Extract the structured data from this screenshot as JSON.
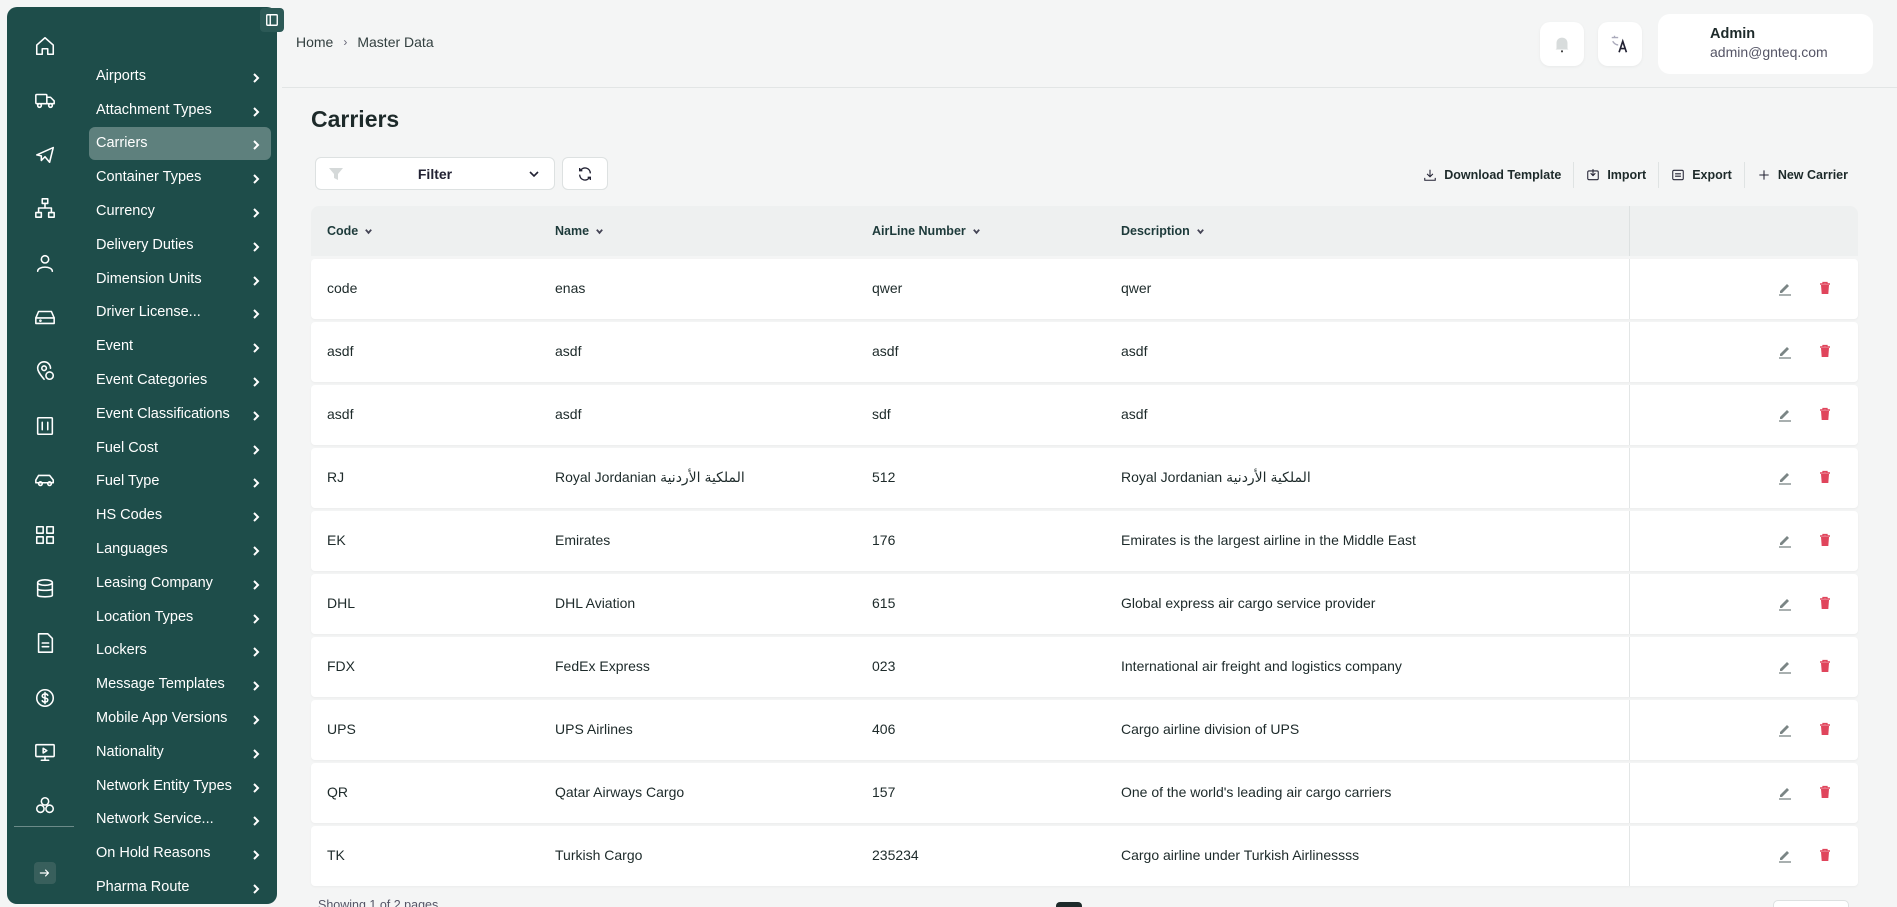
{
  "sidebar": {
    "rail_icons": [
      "home-icon",
      "truck-icon",
      "airplane-icon",
      "sitemap-icon",
      "user-icon",
      "hard-drive-icon",
      "map-pin-icon",
      "building-icon",
      "car-icon",
      "dashboard-icon",
      "database-icon",
      "document-icon",
      "dollar-icon",
      "monitor-icon",
      "network-icon"
    ],
    "logout_icon": "logout-icon",
    "menu": [
      {
        "label": "Airports"
      },
      {
        "label": "Attachment Types"
      },
      {
        "label": "Carriers",
        "active": true
      },
      {
        "label": "Container Types"
      },
      {
        "label": "Currency"
      },
      {
        "label": "Delivery Duties"
      },
      {
        "label": "Dimension Units"
      },
      {
        "label": "Driver License..."
      },
      {
        "label": "Event"
      },
      {
        "label": "Event Categories"
      },
      {
        "label": "Event Classifications"
      },
      {
        "label": "Fuel Cost"
      },
      {
        "label": "Fuel Type"
      },
      {
        "label": "HS Codes"
      },
      {
        "label": "Languages"
      },
      {
        "label": "Leasing Company"
      },
      {
        "label": "Location Types"
      },
      {
        "label": "Lockers"
      },
      {
        "label": "Message Templates"
      },
      {
        "label": "Mobile App Versions"
      },
      {
        "label": "Nationality"
      },
      {
        "label": "Network Entity Types"
      },
      {
        "label": "Network Service..."
      },
      {
        "label": "On Hold Reasons"
      },
      {
        "label": "Pharma Route"
      }
    ]
  },
  "header": {
    "breadcrumb": {
      "home": "Home",
      "current": "Master Data"
    },
    "user": {
      "name": "Admin",
      "email": "admin@gnteq.com"
    }
  },
  "page": {
    "title": "Carriers",
    "filter_label": "Filter",
    "actions": {
      "download_template": "Download Template",
      "import": "Import",
      "export": "Export",
      "new_carrier": "New Carrier"
    }
  },
  "table": {
    "columns": {
      "code": "Code",
      "name": "Name",
      "airline_number": "AirLine Number",
      "description": "Description"
    },
    "rows": [
      {
        "code": "code",
        "name": "enas",
        "airline_number": "qwer",
        "description": "qwer"
      },
      {
        "code": "asdf",
        "name": "asdf",
        "airline_number": "asdf",
        "description": "asdf"
      },
      {
        "code": "asdf",
        "name": "asdf",
        "airline_number": "sdf",
        "description": "asdf"
      },
      {
        "code": "RJ",
        "name": "Royal Jordanian الملكية الأردنية",
        "airline_number": "512",
        "description": "Royal Jordanian الملكية الأردنية"
      },
      {
        "code": "EK",
        "name": "Emirates",
        "airline_number": "176",
        "description": "Emirates is the largest airline in the Middle East"
      },
      {
        "code": "DHL",
        "name": "DHL Aviation",
        "airline_number": "615",
        "description": "Global express air cargo service provider"
      },
      {
        "code": "FDX",
        "name": "FedEx Express",
        "airline_number": "023",
        "description": "International air freight and logistics company"
      },
      {
        "code": "UPS",
        "name": "UPS Airlines",
        "airline_number": "406",
        "description": "Cargo airline division of UPS"
      },
      {
        "code": "QR",
        "name": "Qatar Airways Cargo",
        "airline_number": "157",
        "description": "One of the world's leading air cargo carriers"
      },
      {
        "code": "TK",
        "name": "Turkish Cargo",
        "airline_number": "235234",
        "description": "Cargo airline under Turkish Airlinessss"
      }
    ]
  },
  "footer": {
    "showing": "Showing 1 of 2 pages"
  },
  "colors": {
    "sidebar": "#1e4d4a",
    "active_item": "#5e807d",
    "delete": "#e0455c"
  }
}
